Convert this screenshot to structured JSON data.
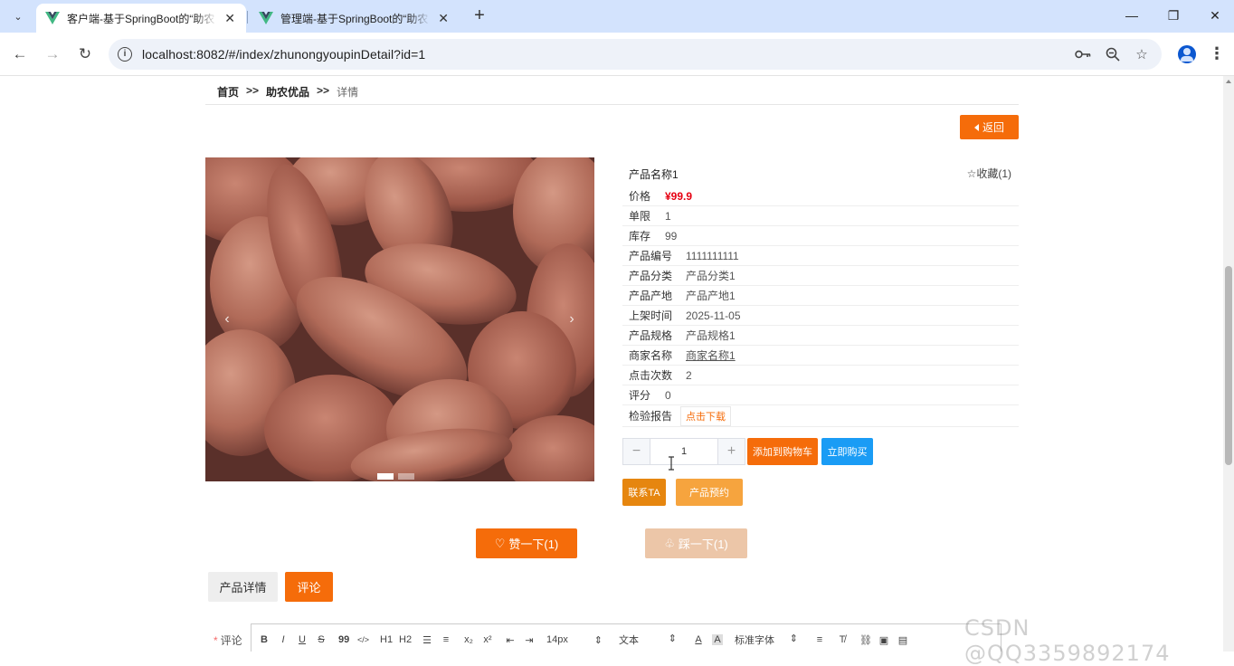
{
  "browser": {
    "tabs": [
      {
        "title": "客户端-基于SpringBoot的“助农",
        "active": true
      },
      {
        "title": "管理端-基于SpringBoot的“助农",
        "active": false
      }
    ],
    "url": "localhost:8082/#/index/zhunongyoupinDetail?id=1"
  },
  "breadcrumb": {
    "home": "首页",
    "sep": ">>",
    "section": "助农优品",
    "current": "详情"
  },
  "back_button": "返回",
  "product": {
    "name": "产品名称1",
    "favorite": "收藏(1)",
    "rows": {
      "price": {
        "label": "价格",
        "value": "¥99.9"
      },
      "limit": {
        "label": "单限",
        "value": "1"
      },
      "stock": {
        "label": "库存",
        "value": "99"
      },
      "code": {
        "label": "产品编号",
        "value": "1111111111"
      },
      "category": {
        "label": "产品分类",
        "value": "产品分类1"
      },
      "origin": {
        "label": "产品产地",
        "value": "产品产地1"
      },
      "listed": {
        "label": "上架时间",
        "value": "2025-11-05"
      },
      "spec": {
        "label": "产品规格",
        "value": "产品规格1"
      },
      "merchant": {
        "label": "商家名称",
        "value": "商家名称1"
      },
      "clicks": {
        "label": "点击次数",
        "value": "2"
      },
      "rating": {
        "label": "评分",
        "value": "0"
      },
      "report": {
        "label": "检验报告",
        "value": "点击下载"
      }
    },
    "quantity": "1"
  },
  "carousel": {
    "prev": "‹",
    "next": "›",
    "slides": 2,
    "active_slide": 1
  },
  "actions": {
    "add_cart": "添加到购物车",
    "buy_now": "立即购买",
    "contact": "联系TA",
    "reserve": "产品预约",
    "like": "赞一下(1)",
    "dislike": "踩一下(1)"
  },
  "tabs": {
    "detail": "产品详情",
    "comment": "评论"
  },
  "comment": {
    "label": "评论",
    "toolbar": {
      "bold": "B",
      "italic": "I",
      "underline": "U",
      "strike": "S",
      "quote": "99",
      "code": "</>",
      "h1": "H1",
      "h2": "H2",
      "sub": "x₂",
      "sup": "x²",
      "size": "14px",
      "header": "文本",
      "font": "标准字体"
    }
  },
  "watermark": "CSDN @QQ3359892174",
  "colors": {
    "accent": "#f56c0a",
    "blue": "#1a9cf5",
    "price": "#e60012",
    "tabbar": "#d3e3fd"
  }
}
